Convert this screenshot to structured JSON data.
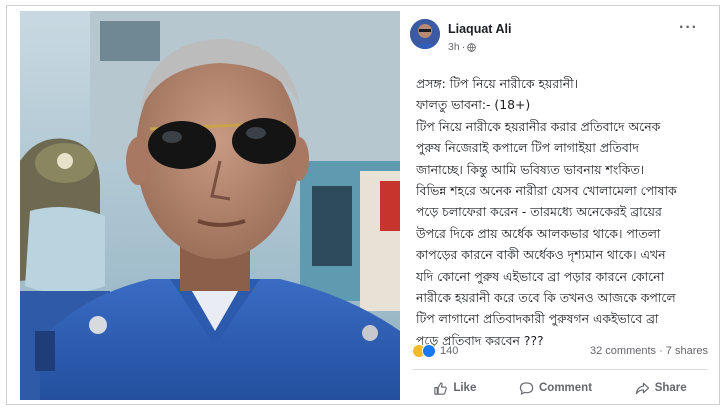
{
  "post": {
    "author": "Liaquat Ali",
    "time": "3h",
    "separator": "·",
    "more_icon": "more-icon",
    "lines": [
      "প্রসঙ্গ: টিপ নিয়ে নারীকে হয়রানী।",
      "ফালতু ভাবনা:-   (18+)",
      "টিপ নিয়ে নারীকে হয়রানীর করার প্রতিবাদে অনেক",
      "পুরুষ নিজেরাই কপালে টিপ লাগাইয়া প্রতিবাদ",
      "জানাচ্ছে। কিন্তু আমি ভবিষ্যত ভাবনায় শংকিত।",
      "বিভিন্ন শহরে অনেক নারীরা যেসব খোলামেলা পোষাক",
      "পড়ে চলাফেরা করেন - তারমধ্যে অনেকেরই ব্রায়ের",
      "উপরে দিকে প্রায় অর্ধেক আলকভার থাকে। পাতলা",
      "কাপড়ের কারনে বাকী অর্ধেকও দৃশ্যমান থাকে। এখন",
      "যদি কোনো পুরুষ এইভাবে ব্রা পড়ার কারনে কোনো",
      "নারীকে হয়রানী করে তবে কি তখনও আজকে কপালে",
      "টিপ লাগানো প্রতিবাদকারী পুরুষগন একইভাবে ব্রা",
      "পড়ে প্রতিবাদ করবেন ???"
    ]
  },
  "stats": {
    "reaction_count": "140",
    "comments_shares": "32 comments · 7 shares"
  },
  "actions": {
    "like": "Like",
    "comment": "Comment",
    "share": "Share"
  },
  "colors": {
    "uniform_blue": "#2f5fb8",
    "text": "#1c1e21",
    "secondary": "#65676b",
    "haha": "#f7b928",
    "like": "#1877f2"
  }
}
